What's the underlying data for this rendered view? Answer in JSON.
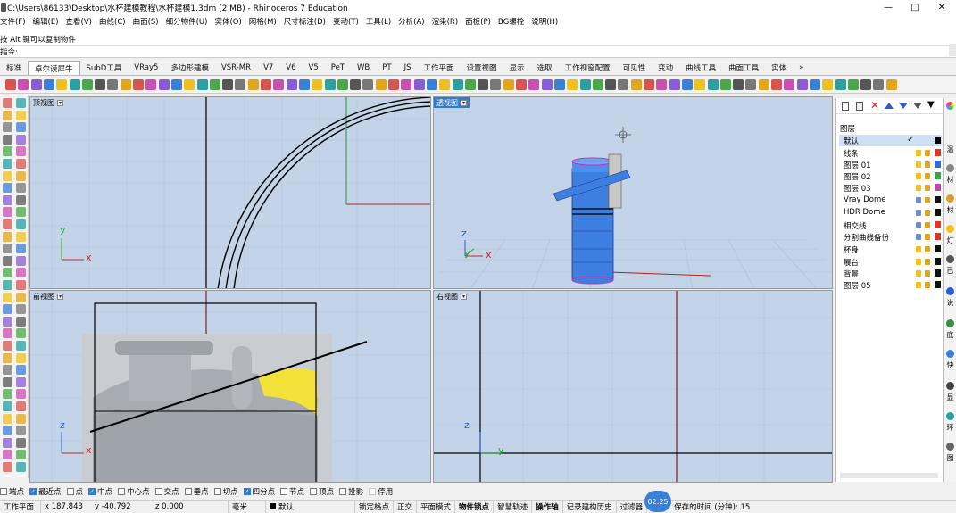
{
  "window": {
    "title": "C:\\Users\\86133\\Desktop\\水杯建模教程\\水杯建模1.3dm (2 MB) - Rhinoceros 7 Education",
    "min": "—",
    "max": "□",
    "close": "✕"
  },
  "menu": [
    "文件(F)",
    "编辑(E)",
    "查看(V)",
    "曲线(C)",
    "曲面(S)",
    "细分物件(U)",
    "实体(O)",
    "网格(M)",
    "尺寸标注(D)",
    "变动(T)",
    "工具(L)",
    "分析(A)",
    "渲染(R)",
    "面板(P)",
    "BG螺栓",
    "说明(H)"
  ],
  "command": {
    "history": "按 Alt 键可以复制物件",
    "prompt": "指令:"
  },
  "tabs": [
    "标准",
    "卓尔谟犀牛",
    "SubD工具",
    "VRay5",
    "多边形建模",
    "VSR-MR",
    "V7",
    "V6",
    "V5",
    "PeT",
    "WB",
    "PT",
    "JS",
    "工作平面",
    "设置视图",
    "显示",
    "选取",
    "工作视窗配置",
    "可见性",
    "变动",
    "曲线工具",
    "曲面工具",
    "实体"
  ],
  "tab_more": "»",
  "viewports": {
    "top": {
      "label": "顶视图",
      "axis_x": "x",
      "axis_y": "y"
    },
    "perspective": {
      "label": "透视图",
      "axis_x": "x",
      "axis_z": "z",
      "axis_y": "y"
    },
    "front": {
      "label": "前视图",
      "axis_x": "x",
      "axis_z": "z"
    },
    "right": {
      "label": "右视图",
      "axis_y": "y",
      "axis_z": "z"
    }
  },
  "layers": {
    "title": "图层",
    "current_check": "✓",
    "items": [
      {
        "name": "默认",
        "color": "#000000",
        "current": true
      },
      {
        "name": "线条",
        "color": "#e0342a"
      },
      {
        "name": "图层 01",
        "color": "#2b6fd6"
      },
      {
        "name": "图层 02",
        "color": "#2ea84a"
      },
      {
        "name": "图层 03",
        "color": "#cc3fb4"
      },
      {
        "name": "Vray Dome",
        "color": "#111111"
      },
      {
        "name": "HDR Dome",
        "color": "#111111"
      },
      {
        "name": "相交线",
        "color": "#e0342a"
      },
      {
        "name": "分割曲线备份",
        "color": "#e0342a"
      },
      {
        "name": "杯身",
        "color": "#111111"
      },
      {
        "name": "展台",
        "color": "#111111"
      },
      {
        "name": "背景",
        "color": "#111111"
      },
      {
        "name": "图层 05",
        "color": "#111111"
      }
    ]
  },
  "right_strip": [
    "温",
    "材",
    "材",
    "灯",
    "已",
    "说",
    "底",
    "快",
    "显",
    "环",
    "图"
  ],
  "osnap": [
    {
      "label": "端点",
      "on": false
    },
    {
      "label": "最近点",
      "on": true
    },
    {
      "label": "点",
      "on": false
    },
    {
      "label": "中点",
      "on": true
    },
    {
      "label": "中心点",
      "on": false
    },
    {
      "label": "交点",
      "on": false
    },
    {
      "label": "垂点",
      "on": false
    },
    {
      "label": "切点",
      "on": false
    },
    {
      "label": "四分点",
      "on": true
    },
    {
      "label": "节点",
      "on": false
    },
    {
      "label": "顶点",
      "on": false
    },
    {
      "label": "投影",
      "on": false
    },
    {
      "label": "停用",
      "on": false
    }
  ],
  "status": {
    "cplane": "工作平面",
    "x": "x 187.843",
    "y": "y -40.792",
    "z": "z 0.000",
    "unit": "毫米",
    "layer": "默认",
    "grid_snap": "锁定格点",
    "ortho": "正交",
    "planar": "平面模式",
    "osnap": "物件锁点",
    "smarttrack": "智慧轨迹",
    "gumball": "操作轴",
    "history": "记录建构历史",
    "filter": "过滤器",
    "autosave": "保存的时间 (分钟): 15",
    "timer": "02:25"
  }
}
